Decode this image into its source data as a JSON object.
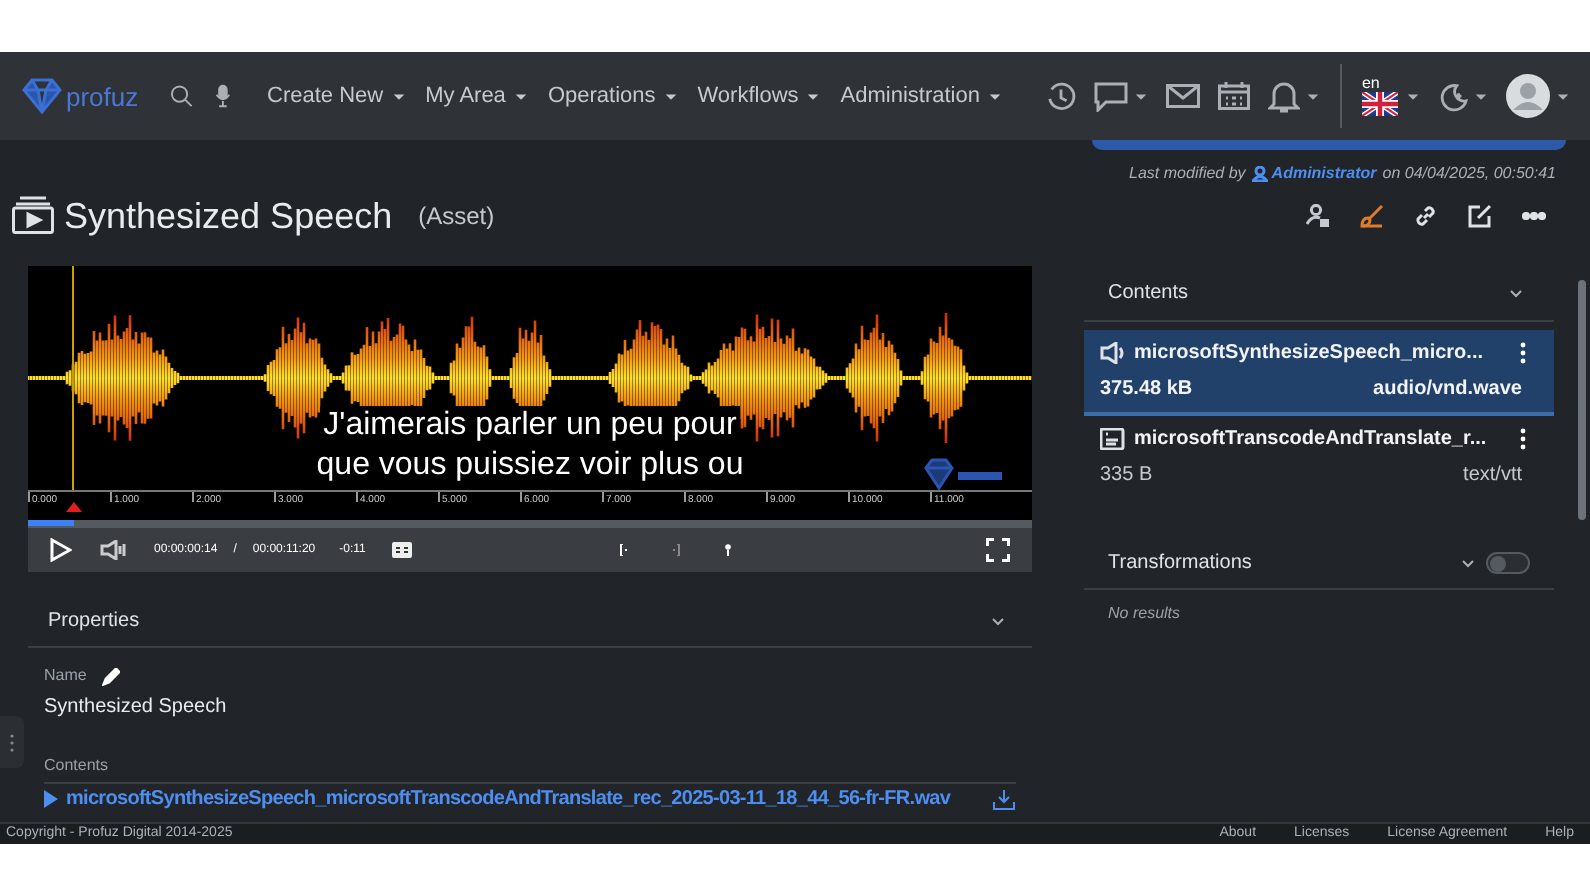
{
  "navbar": {
    "logo_text": "profuz",
    "menus": [
      {
        "label": "Create New"
      },
      {
        "label": "My Area"
      },
      {
        "label": "Operations"
      },
      {
        "label": "Workflows"
      },
      {
        "label": "Administration"
      }
    ],
    "language": "en"
  },
  "header": {
    "title": "Synthesized Speech",
    "type": "(Asset)",
    "last_modified": {
      "prefix": "Last modified by",
      "user": "Administrator",
      "suffix": "on 04/04/2025, 00:50:41"
    }
  },
  "player": {
    "subtitle_lines": [
      "J'aimerais parler un peu pour",
      "que vous puissiez voir plus ou"
    ],
    "timeline_labels": [
      "0.000",
      "1.000",
      "2.000",
      "3.000",
      "4.000",
      "5.000",
      "6.000",
      "7.000",
      "8.000",
      "9.000",
      "10.000",
      "11.000"
    ],
    "level": 0.046,
    "current_time": "00:00:00:14",
    "separator": "/",
    "duration": "00:00:11:20",
    "remaining": "-0:11"
  },
  "properties": {
    "title": "Properties",
    "name_label": "Name",
    "name_value": "Synthesized Speech",
    "contents_label": "Contents",
    "file_link": "microsoftSynthesizeSpeech_microsoftTranscodeAndTranslate_rec_2025-03-11_18_44_56-fr-FR.wav"
  },
  "contents": {
    "title": "Contents",
    "items": [
      {
        "kind": "audio",
        "name": "microsoftSynthesizeSpeech_micro...",
        "size": "375.48 kB",
        "mime": "audio/vnd.wave",
        "selected": true
      },
      {
        "kind": "subtitle",
        "name": "microsoftTranscodeAndTranslate_r...",
        "size": "335 B",
        "mime": "text/vtt",
        "selected": false
      }
    ]
  },
  "transformations": {
    "title": "Transformations",
    "on": false,
    "empty_text": "No results"
  },
  "footer": {
    "copyright": "Copyright - Profuz Digital 2014-2025",
    "links": [
      "About",
      "Licenses",
      "License Agreement",
      "Help"
    ]
  }
}
